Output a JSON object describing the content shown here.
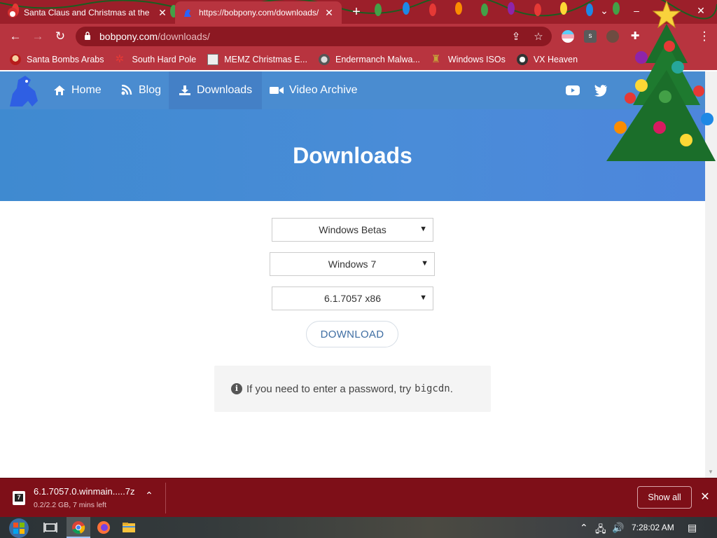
{
  "browser": {
    "tabs": [
      {
        "title": "Santa Claus and Christmas at the",
        "active": false
      },
      {
        "title": "https://bobpony.com/downloads/",
        "active": true
      }
    ],
    "new_tab_label": "+",
    "url_host": "bobpony.com",
    "url_path": "/downloads/",
    "window_controls": {
      "minimize": "–",
      "restore": "❐",
      "close": "✕",
      "tab_search": "⌄"
    }
  },
  "bookmarks": [
    {
      "label": "Santa Bombs Arabs",
      "icon": "santa-icon"
    },
    {
      "label": "South Hard Pole",
      "icon": "snowflake-icon"
    },
    {
      "label": "MEMZ Christmas E...",
      "icon": "memz-icon"
    },
    {
      "label": "Endermanch Malwa...",
      "icon": "raccoon-icon"
    },
    {
      "label": "Windows ISOs",
      "icon": "trophy-icon"
    },
    {
      "label": "VX Heaven",
      "icon": "vx-icon"
    }
  ],
  "site": {
    "nav": [
      {
        "label": "Home",
        "icon": "home-icon",
        "active": false
      },
      {
        "label": "Blog",
        "icon": "blog-icon",
        "active": false
      },
      {
        "label": "Downloads",
        "icon": "download-icon",
        "active": true
      },
      {
        "label": "Video Archive",
        "icon": "video-icon",
        "active": false
      }
    ],
    "hero_title": "Downloads",
    "selects": {
      "category": "Windows Betas",
      "product": "Windows 7",
      "build": "6.1.7057 x86"
    },
    "download_button": "DOWNLOAD",
    "notice_text": "If you need to enter a password, try",
    "notice_password": "bigcdn",
    "notice_end": "."
  },
  "download_shelf": {
    "filename": "6.1.7057.0.winmain.....7z",
    "status": "0.2/2.2 GB, 7 mins left",
    "show_all": "Show all"
  },
  "taskbar": {
    "clock": "7:28:02 AM"
  },
  "colors": {
    "browser_frame": "#9c1f2a",
    "site_accent": "#4a8cd0",
    "download_shelf": "#7e0f18"
  }
}
